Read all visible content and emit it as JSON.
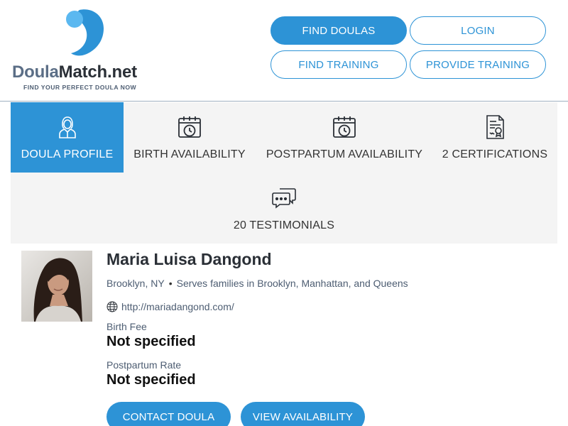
{
  "brand": {
    "name_part1": "Doula",
    "name_part2": "Match.net",
    "tagline": "FIND YOUR PERFECT DOULA NOW",
    "primary_color": "#2d93d6",
    "light_color": "#5bb8f0"
  },
  "nav": {
    "find_doulas": "FIND DOULAS",
    "login": "LOGIN",
    "find_training": "FIND TRAINING",
    "provide_training": "PROVIDE TRAINING"
  },
  "tabs": [
    {
      "label": "DOULA PROFILE",
      "icon": "doula-person-icon",
      "active": true
    },
    {
      "label": "BIRTH AVAILABILITY",
      "icon": "calendar-clock-icon",
      "active": false
    },
    {
      "label": "POSTPARTUM AVAILABILITY",
      "icon": "calendar-clock-icon",
      "active": false
    },
    {
      "label": "2 CERTIFICATIONS",
      "icon": "certificate-icon",
      "active": false
    },
    {
      "label": "20 TESTIMONIALS",
      "icon": "chat-bubbles-icon",
      "active": false
    }
  ],
  "profile": {
    "name": "Maria Luisa Dangond",
    "location": "Brooklyn, NY",
    "separator": "•",
    "serves": "Serves families in Brooklyn, Manhattan, and Queens",
    "website": "http://mariadangond.com/",
    "birth_fee_label": "Birth Fee",
    "birth_fee_value": "Not specified",
    "postpartum_label": "Postpartum Rate",
    "postpartum_value": "Not specified"
  },
  "actions": {
    "contact": "CONTACT DOULA",
    "availability": "VIEW AVAILABILITY"
  }
}
